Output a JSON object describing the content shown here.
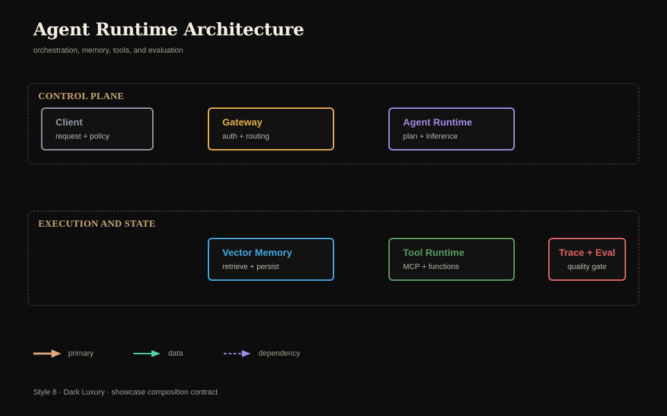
{
  "header": {
    "title": "Agent Runtime Architecture",
    "subtitle": "orchestration, memory, tools, and evaluation"
  },
  "zones": [
    {
      "label": "CONTROL PLANE"
    },
    {
      "label": "EXECUTION AND STATE"
    }
  ],
  "nodes": {
    "client": {
      "title": "Client",
      "sub": "request + policy",
      "color": "#8e9aa8"
    },
    "gateway": {
      "title": "Gateway",
      "sub": "auth + routing",
      "color": "#e8b04a"
    },
    "agent_runtime": {
      "title": "Agent Runtime",
      "sub": "plan + inference",
      "color": "#a48ae6"
    },
    "vector_memory": {
      "title": "Vector Memory",
      "sub": "retrieve + persist",
      "color": "#41a8e0"
    },
    "tool_runtime": {
      "title": "Tool Runtime",
      "sub": "MCP + functions",
      "color": "#5c9a62"
    },
    "trace_eval": {
      "title": "Trace + Eval",
      "sub": "quality gate",
      "color": "#e06464"
    }
  },
  "legend": [
    {
      "label": "primary",
      "color": "#e0a877",
      "style": "solid-thick"
    },
    {
      "label": "data",
      "color": "#4fd4ae",
      "style": "solid"
    },
    {
      "label": "dependency",
      "color": "#a48ae6",
      "style": "dashed"
    }
  ],
  "footer": "Style 8 · Dark Luxury · showcase composition contract"
}
